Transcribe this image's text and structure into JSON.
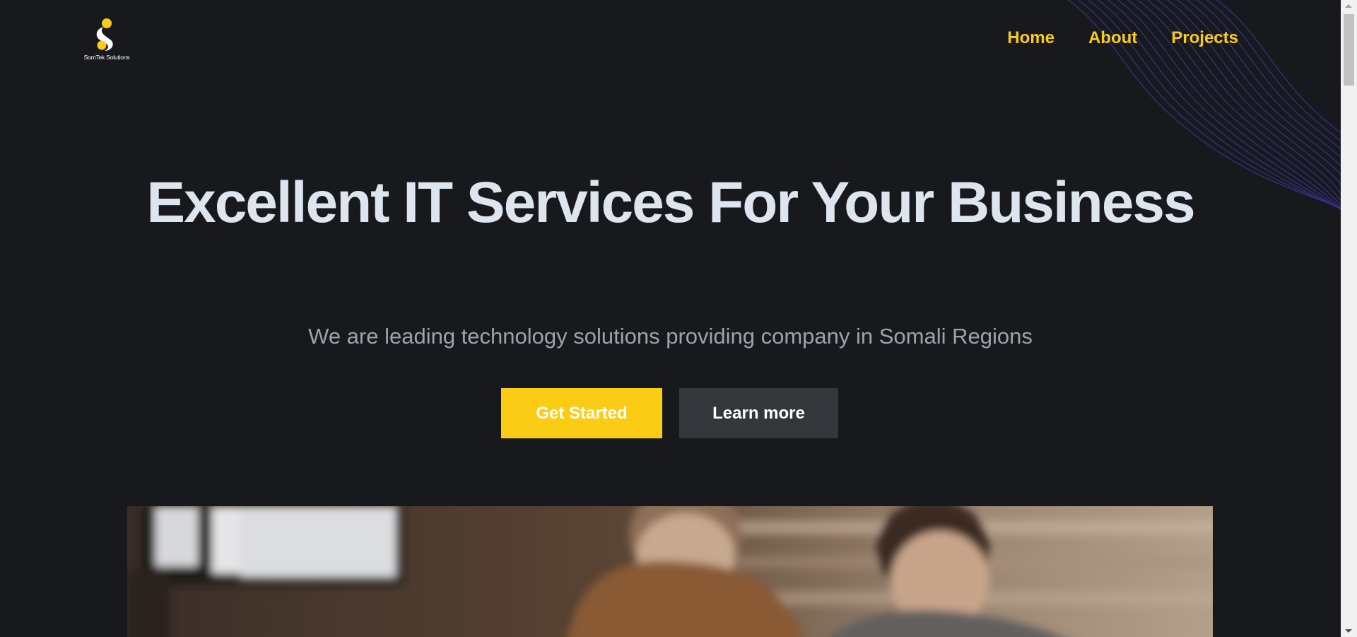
{
  "brand": {
    "name": "SomTek Solutions",
    "accent": "#facc15"
  },
  "nav": {
    "items": [
      {
        "label": "Home"
      },
      {
        "label": "About"
      },
      {
        "label": "Projects"
      }
    ]
  },
  "hero": {
    "title": "Excellent IT Services For Your Business",
    "subtitle": "We are leading technology solutions providing company in Somali Regions",
    "primary_cta": "Get Started",
    "secondary_cta": "Learn more"
  },
  "colors": {
    "background": "#18191c",
    "title": "#dde5ee",
    "subtitle": "#9ca3af",
    "secondary_button": "#34363b",
    "wave_lines": "#33338a"
  }
}
